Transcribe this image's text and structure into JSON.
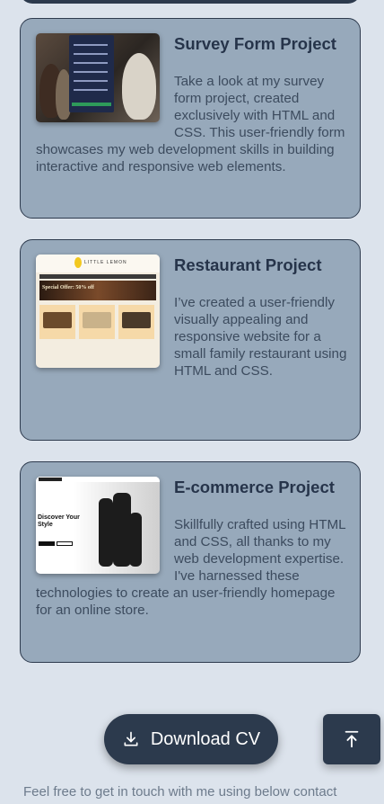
{
  "projects": [
    {
      "title": "Survey Form Project",
      "description": "Take a look at my survey form project, created exclusively with HTML and CSS. This user-friendly form showcases my web development skills in building interactive and responsive web elements."
    },
    {
      "title": "Restaurant Project",
      "description": "I’ve created a user-friendly visually appealing and responsive website for a small family restaurant using HTML and CSS."
    },
    {
      "title": "E-commerce Project",
      "description": "Skillfully crafted using HTML and CSS, all thanks to my web development expertise. I've harnessed these technologies to create an user-friendly homepage for an online store."
    }
  ],
  "thumbs": {
    "restaurant_brand": "LITTLE LEMON",
    "restaurant_hero": "Special Offer: 50% off",
    "ecommerce_heading": "Discover Your Style"
  },
  "download_label": "Download CV",
  "footer_text": "Feel free to get in touch with me using below contact",
  "colors": {
    "page_bg": "#dce3ec",
    "card_bg": "#97a9bb",
    "dark": "#2c3a4d"
  },
  "icons": {
    "download": "download-icon",
    "scroll_top": "arrow-up-to-line-icon"
  }
}
